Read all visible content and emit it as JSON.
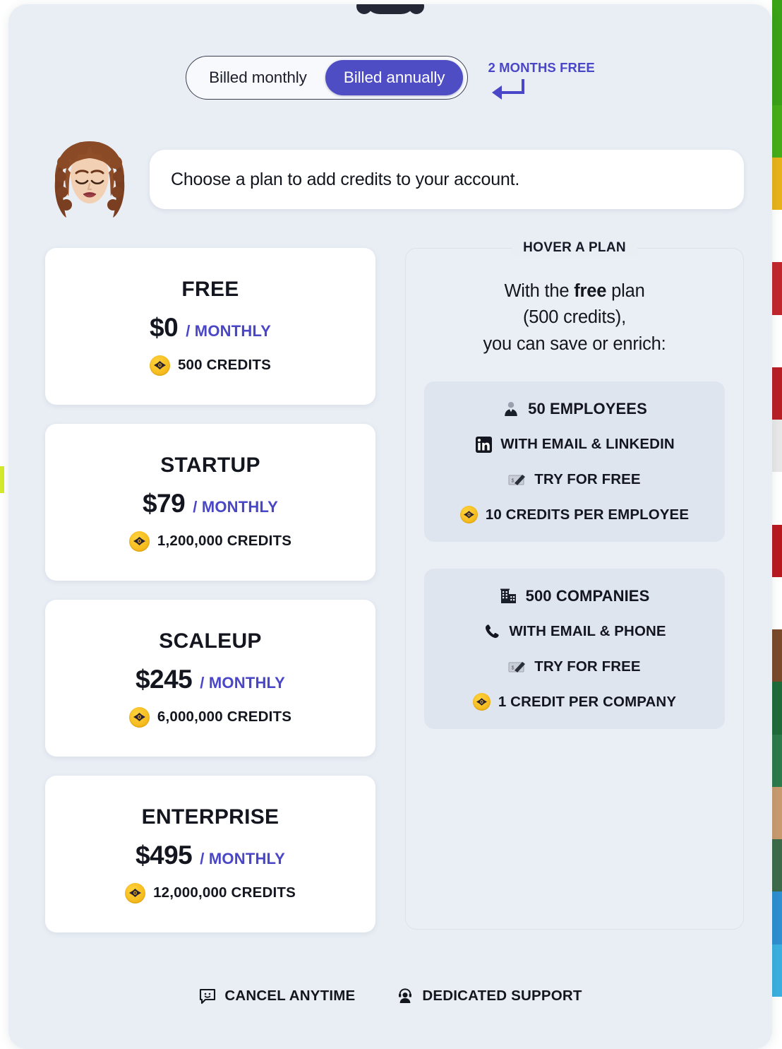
{
  "billing": {
    "options": [
      {
        "label": "Billed monthly",
        "active": false
      },
      {
        "label": "Billed annually",
        "active": true
      }
    ],
    "promo_text": "2 MONTHS FREE"
  },
  "assistant": {
    "message": "Choose a plan to add credits to your account."
  },
  "plans": [
    {
      "name": "FREE",
      "price": "$0",
      "period": "/ MONTHLY",
      "credits": "500 CREDITS"
    },
    {
      "name": "STARTUP",
      "price": "$79",
      "period": "/ MONTHLY",
      "credits": "1,200,000 CREDITS"
    },
    {
      "name": "SCALEUP",
      "price": "$245",
      "period": "/ MONTHLY",
      "credits": "6,000,000 CREDITS"
    },
    {
      "name": "ENTERPRISE",
      "price": "$495",
      "period": "/ MONTHLY",
      "credits": "12,000,000 CREDITS"
    }
  ],
  "hover_panel": {
    "legend": "HOVER A PLAN",
    "headline_line1_pre": "With the ",
    "headline_line1_strong": "free",
    "headline_line1_post": " plan",
    "headline_line2": "(500 credits),",
    "headline_line3": "you can save or enrich:",
    "boxes": [
      {
        "rows": [
          {
            "icon": "person-icon",
            "text": "50 EMPLOYEES"
          },
          {
            "icon": "linkedin-icon",
            "text": "WITH EMAIL & LINKEDIN"
          },
          {
            "icon": "cheque-icon",
            "text": "TRY FOR FREE"
          },
          {
            "icon": "credit-coin-icon",
            "text": "10 CREDITS PER EMPLOYEE"
          }
        ]
      },
      {
        "rows": [
          {
            "icon": "building-icon",
            "text": "500 COMPANIES"
          },
          {
            "icon": "phone-icon",
            "text": "WITH EMAIL & PHONE"
          },
          {
            "icon": "cheque-icon",
            "text": "TRY FOR FREE"
          },
          {
            "icon": "credit-coin-icon",
            "text": "1 CREDIT PER COMPANY"
          }
        ]
      }
    ]
  },
  "footer": [
    {
      "icon": "chat-smile-icon",
      "text": "CANCEL ANYTIME"
    },
    {
      "icon": "support-agent-icon",
      "text": "DEDICATED SUPPORT"
    }
  ],
  "colors": {
    "accent": "#4f4dc4",
    "accent_text": "#4a46c8",
    "modal_bg": "#e9eef5",
    "card_bg": "#ffffff",
    "feature_box_bg": "#dfe5ee",
    "coin_gold": "#f5b91a",
    "text_dark": "#14161f"
  },
  "background_strip_right": [
    "#3aa216",
    "#3aa216",
    "#46ad18",
    "#e8b21b",
    "#ffffff",
    "#c2272d",
    "#ffffff",
    "#b81f25",
    "#e8e8e8",
    "#ffffff",
    "#b8191f",
    "#ffffff",
    "#7a4a2a",
    "#1f6b3a",
    "#2d7a4a",
    "#c99a6e",
    "#3d6b4a",
    "#2f8fd0",
    "#3bb0e0",
    "#ffffff"
  ]
}
